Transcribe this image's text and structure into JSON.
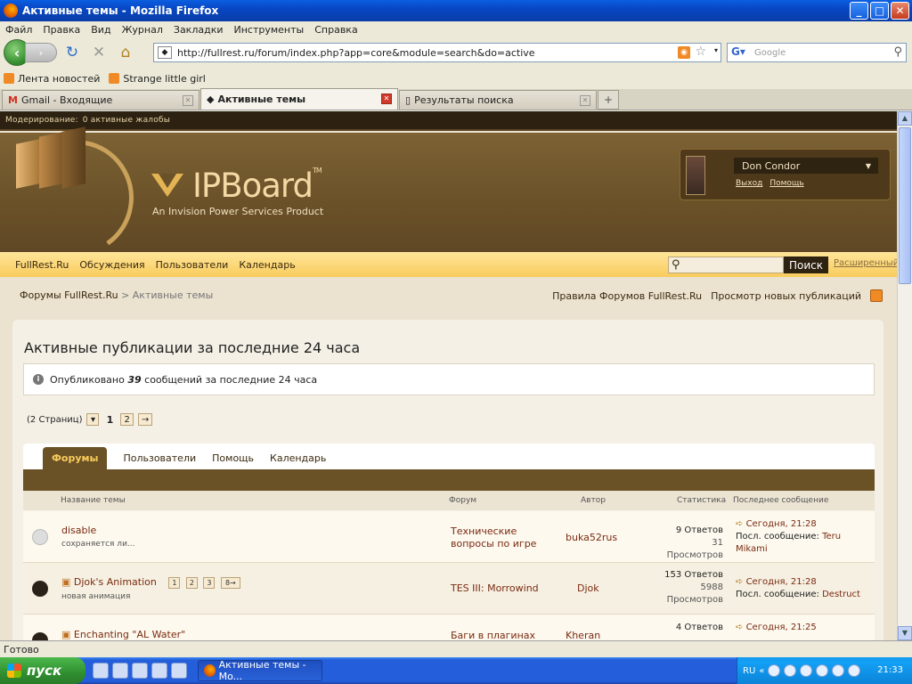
{
  "window": {
    "title": "Активные темы - Mozilla Firefox",
    "min": "_",
    "max": "□",
    "close": "✕"
  },
  "menu": [
    "Файл",
    "Правка",
    "Вид",
    "Журнал",
    "Закладки",
    "Инструменты",
    "Справка"
  ],
  "nav": {
    "url": "http://fullrest.ru/forum/index.php?app=core&module=search&do=active",
    "search_placeholder": "Google",
    "back": "‹",
    "fwd": "›",
    "reload": "↻",
    "stop": "✕",
    "home": "⌂"
  },
  "bookmarks": [
    "Лента новостей",
    "Strange little girl"
  ],
  "tabs": [
    {
      "label": "Gmail - Входящие",
      "icon": "M"
    },
    {
      "label": "Активные темы",
      "icon": "◆"
    },
    {
      "label": "Результаты поиска",
      "icon": "▯"
    }
  ],
  "tab_new": "+",
  "page": {
    "mod_label": "Модерирование:",
    "mod_value": "0 активные жалобы",
    "logo": {
      "text": "IPBoard",
      "tm": "TM",
      "sub": "An Invision Power Services Product"
    },
    "user": {
      "name": "Don Condor",
      "logout": "Выход",
      "help": "Помощь"
    },
    "mainnav": [
      "FullRest.Ru",
      "Обсуждения",
      "Пользователи",
      "Календарь"
    ],
    "search_btn": "Поиск",
    "search_adv": "Расширенный",
    "breadcrumb": {
      "root": "Форумы FullRest.Ru",
      "sep": ">",
      "current": "Активные темы"
    },
    "crumb_links": [
      "Правила Форумов FullRest.Ru",
      "Просмотр новых публикаций"
    ],
    "title": "Активные публикации за последние 24 часа",
    "info": {
      "prefix": "Опубликовано",
      "count": "39",
      "suffix": "сообщений за последние 24 часа"
    },
    "pager": {
      "label": "(2 Страниц)",
      "drop": "▾",
      "current": "1",
      "next_page": "2",
      "next": "→"
    },
    "subtabs": [
      "Форумы",
      "Пользователи",
      "Помощь",
      "Календарь"
    ],
    "columns": {
      "topic": "Название темы",
      "forum": "Форум",
      "author": "Автор",
      "stats": "Статистика",
      "last": "Последнее сообщение"
    },
    "rows": [
      {
        "title": "disable",
        "desc": "сохраняется ли...",
        "forum": "Технические вопросы по игре",
        "author": "buka52rus",
        "replies": "9 Ответов",
        "views": "31 Просмотров",
        "last_date": "Сегодня, 21:28",
        "last_label": "Посл. сообщение:",
        "last_user": "Teru Mikami"
      },
      {
        "title": "Djok's Animation",
        "desc": "новая анимация",
        "forum": "TES III: Morrowind",
        "author": "Djok",
        "replies": "153 Ответов",
        "views_num": "5988",
        "views_label": "Просмотров",
        "last_date": "Сегодня, 21:28",
        "last_label": "Посл. сообщение:",
        "last_user": "Destruct",
        "pages": [
          "1",
          "2",
          "3",
          "8→"
        ]
      },
      {
        "title": "Enchanting \"AL Water\"",
        "forum": "Баги в плагинах",
        "author": "Kheran",
        "replies": "4 Ответов",
        "last_date": "Сегодня, 21:25"
      }
    ]
  },
  "status": "Готово",
  "taskbar": {
    "start": "пуск",
    "task": "Активные темы - Mo...",
    "lang": "RU",
    "clock": "21:33"
  }
}
